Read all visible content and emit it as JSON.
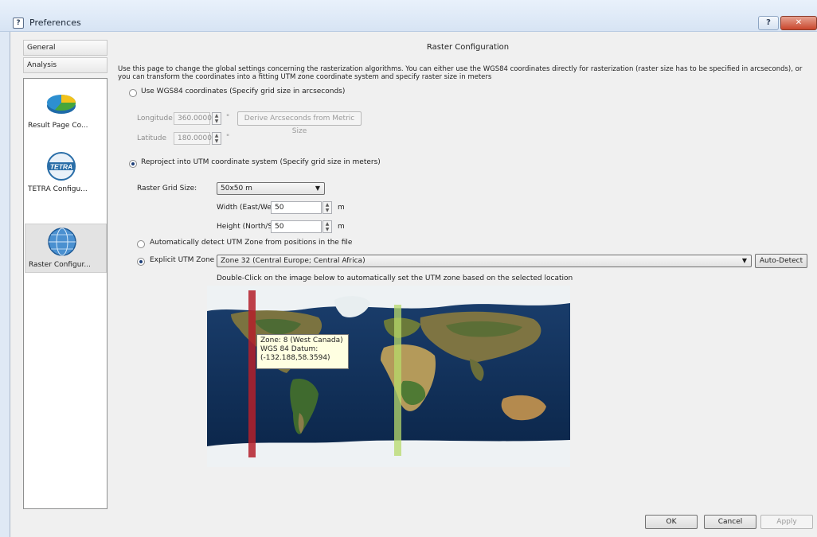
{
  "window": {
    "title": "Preferences",
    "help_button": "?",
    "close_button": "✕"
  },
  "sidebar": {
    "headers": [
      "General",
      "Analysis"
    ],
    "items": [
      {
        "label": "Result Page Co...",
        "icon": "pie-chart-icon"
      },
      {
        "label": "TETRA Configu...",
        "icon": "tetra-logo-icon",
        "logo_text": "TETRA"
      },
      {
        "label": "Raster Configur...",
        "icon": "globe-icon",
        "selected": true
      }
    ]
  },
  "main": {
    "heading": "Raster Configuration",
    "description_1": "Use this page to change the global settings concerning the rasterization algorithms. You can either use the WGS84 coordinates directly for rasterization (raster size has to be specified in arcseconds), or",
    "description_2": "you can transform the coordinates into a fitting UTM zone coordinate system and specify raster size in meters",
    "wgs84": {
      "label": "Use WGS84 coordinates (Specify grid size in arcseconds)",
      "longitude_label": "Longitude",
      "longitude_value": "360.0000",
      "latitude_label": "Latitude",
      "latitude_value": "180.0000",
      "unit": "\"",
      "derive_button": "Derive Arcseconds from Metric Size"
    },
    "utm": {
      "label": "Reproject into UTM coordinate system (Specify grid size in meters)",
      "grid_size_label": "Raster Grid Size:",
      "grid_size_value": "50x50 m",
      "width_label": "Width (East/West)",
      "width_value": "50",
      "height_label": "Height (North/South)",
      "height_value": "50",
      "unit": "m",
      "auto_detect_label": "Automatically detect UTM Zone from positions in the file",
      "explicit_label": "Explicit UTM Zone",
      "zone_value": "Zone 32 (Central Europe; Central Africa)",
      "auto_detect_button": "Auto-Detect",
      "map_hint": "Double-Click on the image below to automatically set the UTM zone based on the selected location"
    },
    "tooltip": {
      "line1": "Zone: 8 (West Canada)",
      "line2": "WGS 84 Datum:",
      "line3": "(-132.188,58.3594)"
    }
  },
  "footer": {
    "ok": "OK",
    "cancel": "Cancel",
    "apply": "Apply"
  },
  "colors": {
    "selected_zone": "#b4202a",
    "hover_zone": "#b7d96b"
  }
}
